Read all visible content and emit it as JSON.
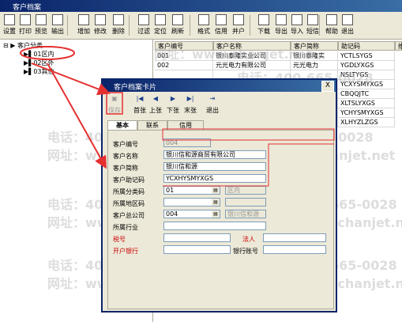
{
  "window": {
    "title": "客户档案"
  },
  "toolbar": {
    "buttons": [
      "设置",
      "打印",
      "预览",
      "输出",
      "增加",
      "修改",
      "删除",
      "过滤",
      "定位",
      "刷新",
      "格式",
      "信用",
      "并户",
      "下载",
      "导出",
      "导入",
      "短信",
      "帮助",
      "退出"
    ]
  },
  "tree": {
    "root": "客户分类",
    "items": [
      "01区内",
      "02区外",
      "03其他"
    ]
  },
  "grid": {
    "headers": [
      "客户编号",
      "客户名称",
      "客户简称",
      "助记码",
      "维"
    ],
    "rows": [
      [
        "001",
        "银川泰隆实业公司",
        "银川泰隆实",
        "YCTLSYGS"
      ],
      [
        "002",
        "元光电力有限公司",
        "元光电力",
        "YGDLYXGS"
      ],
      [
        "",
        "",
        "",
        "NSLTYGS"
      ],
      [
        "",
        "",
        "",
        "YCXYSMYXGS"
      ],
      [
        "",
        "",
        "",
        "CBQQJTC"
      ],
      [
        "",
        "",
        "",
        "XLTSLYXGS"
      ],
      [
        "",
        "",
        "",
        "YCHYSMYXGS"
      ],
      [
        "",
        "",
        "",
        "XLHYZLZGS"
      ]
    ]
  },
  "dialog": {
    "title": "客户档案卡片",
    "close": "X",
    "toolbar": [
      "保存",
      "首张",
      "上张",
      "下张",
      "末张",
      "退出"
    ],
    "tabs": [
      "基本",
      "联系",
      "信用"
    ],
    "fields": {
      "code_label": "客户编号",
      "code_value": "004",
      "name_label": "客户名称",
      "name_value": "银川信和源商贸有限公司",
      "short_label": "客户简称",
      "short_value": "银川信和源",
      "mnemonic_label": "客户助记码",
      "mnemonic_value": "YCXHYSMYXGS",
      "category_label": "所属分类码",
      "category_value": "01",
      "category_name": "区内",
      "region_label": "所属地区码",
      "hq_label": "客户总公司",
      "hq_value": "004",
      "hq_name": "银川信和源",
      "industry_label": "所属行业",
      "tax_label": "税号",
      "legal_label": "法人",
      "bank_label": "开户银行",
      "account_label": "银行账号"
    }
  },
  "watermark": {
    "phone": "电话：400-665-0028",
    "site": "网址：www.chanjet.net"
  },
  "colors": {
    "annotation": "#e53030",
    "title_bar": "#0a246a"
  }
}
